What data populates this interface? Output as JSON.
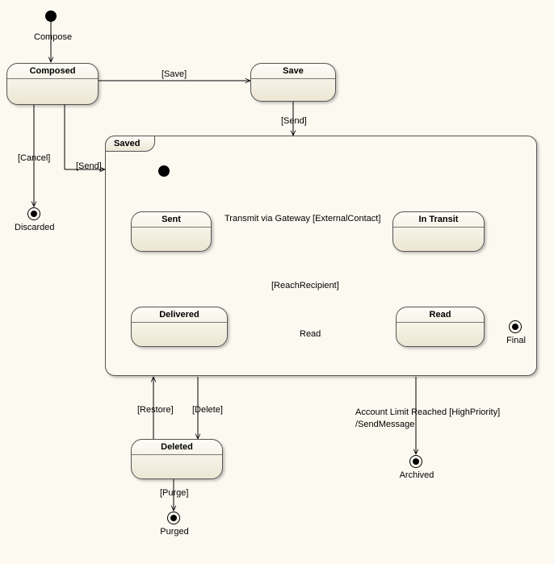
{
  "chart_data": {
    "type": "uml-state-diagram",
    "initial": "Compose",
    "states": [
      "Composed",
      "Save",
      "Discarded",
      "Saved",
      "Sent",
      "In Transit",
      "Delivered",
      "Read",
      "Final",
      "Deleted",
      "Purged",
      "Archived"
    ],
    "composite": {
      "Saved": [
        "Sent",
        "In Transit",
        "Delivered",
        "Read"
      ]
    },
    "final_states": [
      "Discarded",
      "Final",
      "Purged",
      "Archived"
    ],
    "transitions": [
      {
        "from": "Initial",
        "to": "Composed",
        "label": "Compose"
      },
      {
        "from": "Composed",
        "to": "Discarded",
        "label": "[Cancel]"
      },
      {
        "from": "Composed",
        "to": "Save",
        "label": "[Save]"
      },
      {
        "from": "Composed",
        "to": "Saved",
        "label": "[Send]"
      },
      {
        "from": "Save",
        "to": "Saved",
        "label": "[Send]"
      },
      {
        "from": "Saved.Initial",
        "to": "Sent"
      },
      {
        "from": "Sent",
        "to": "In Transit",
        "label": "Transmit via Gateway [ExternalContact]"
      },
      {
        "from": "Sent",
        "to": "Delivered"
      },
      {
        "from": "In Transit",
        "to": "Delivered",
        "label": "[ReachRecipient]"
      },
      {
        "from": "Delivered",
        "to": "Read",
        "label": "Read"
      },
      {
        "from": "Read",
        "to": "Final"
      },
      {
        "from": "Saved",
        "to": "Deleted",
        "label": "[Delete]"
      },
      {
        "from": "Deleted",
        "to": "Saved",
        "label": "[Restore]"
      },
      {
        "from": "Deleted",
        "to": "Purged",
        "label": "[Purge]"
      },
      {
        "from": "Saved",
        "to": "Archived",
        "label": "Account Limit Reached [HighPriority]\n/SendMessage"
      }
    ]
  },
  "labels": {
    "compose": "Compose",
    "composed": "Composed",
    "save": "Save",
    "cancel": "[Cancel]",
    "discarded": "Discarded",
    "saveGuard": "[Save]",
    "sendGuard": "[Send]",
    "sendGuard2": "[Send]",
    "saved": "Saved",
    "sent": "Sent",
    "inTransit": "In Transit",
    "transmit": "Transmit via Gateway [ExternalContact]",
    "reach": "[ReachRecipient]",
    "delivered": "Delivered",
    "read": "Read",
    "readEvt": "Read",
    "final": "Final",
    "restore": "[Restore]",
    "delete": "[Delete]",
    "deleted": "Deleted",
    "purge": "[Purge]",
    "purged": "Purged",
    "archiveEvt1": "Account Limit Reached [HighPriority]",
    "archiveEvt2": "/SendMessage",
    "archived": "Archived"
  }
}
